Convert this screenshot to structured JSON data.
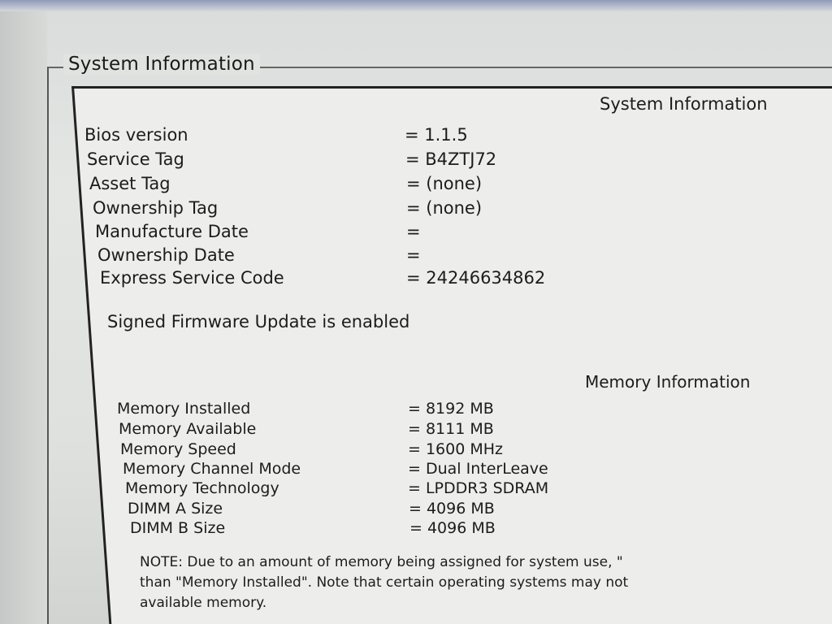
{
  "group": {
    "legend": "System Information"
  },
  "system": {
    "title": "System Information",
    "rows": [
      {
        "label": "Bios version",
        "value": "= 1.1.5"
      },
      {
        "label": "Service Tag",
        "value": "= B4ZTJ72"
      },
      {
        "label": "Asset Tag",
        "value": "= (none)"
      },
      {
        "label": "Ownership Tag",
        "value": "= (none)"
      },
      {
        "label": "Manufacture Date",
        "value": "="
      },
      {
        "label": "Ownership Date",
        "value": "="
      },
      {
        "label": "Express Service Code",
        "value": "= 24246634862"
      }
    ],
    "firmware_note": "Signed Firmware Update is enabled"
  },
  "memory": {
    "title": "Memory Information",
    "rows": [
      {
        "label": "Memory Installed",
        "value": "= 8192 MB"
      },
      {
        "label": "Memory Available",
        "value": "= 8111 MB"
      },
      {
        "label": "Memory Speed",
        "value": "= 1600 MHz"
      },
      {
        "label": "Memory Channel Mode",
        "value": "= Dual InterLeave"
      },
      {
        "label": "Memory Technology",
        "value": "= LPDDR3 SDRAM"
      },
      {
        "label": "DIMM A Size",
        "value": "= 4096 MB"
      },
      {
        "label": "DIMM B Size",
        "value": "= 4096 MB"
      }
    ],
    "note_lines": [
      "NOTE: Due to an amount of memory being assigned for system use, \"",
      "than \"Memory Installed\". Note that certain operating systems may not",
      "available memory."
    ]
  }
}
